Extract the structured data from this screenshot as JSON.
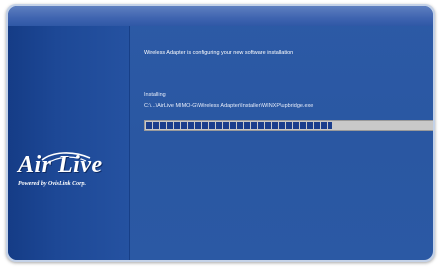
{
  "installer": {
    "message": "Wireless Adapter is configuring your new software installation",
    "status_label": "Installing",
    "current_file": "C:\\...\\AirLive MIMO-G\\Wireless Adapter\\Installer\\WINXP\\upbridge.exe",
    "progress": 0.64
  },
  "branding": {
    "logo_text": "Air Live",
    "logo_tagline": "Powered by OvisLink Corp."
  },
  "colors": {
    "window_bg": "#2b59a4",
    "side_panel": "#1d4896",
    "progress_fill": "#1a3d8c",
    "progress_track": "#c9c9c9"
  }
}
